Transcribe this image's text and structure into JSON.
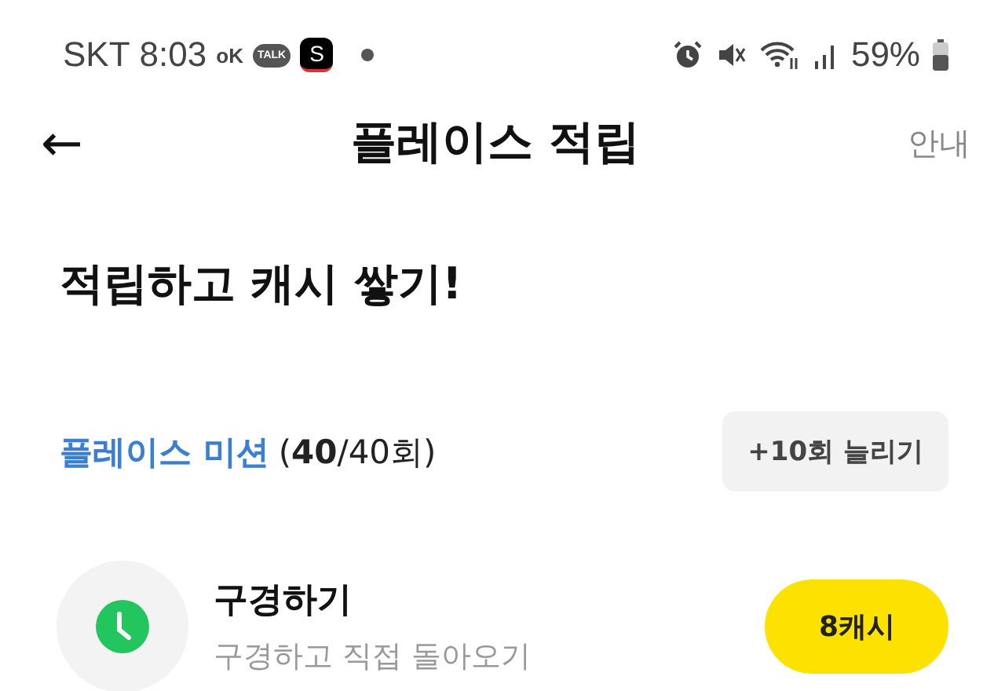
{
  "status_bar": {
    "carrier": "SKT",
    "time": "8:03",
    "ok_badge": "oK",
    "talk_badge": "TALK",
    "s_badge": "S",
    "battery": "59%"
  },
  "header": {
    "back": "←",
    "title": "플레이스 적립",
    "info": "안내"
  },
  "headline": "적립하고 캐시 쌓기!",
  "mission": {
    "title": "플레이스 미션",
    "count": "(**40**/40회)",
    "extend_button": "+10회 늘리기"
  },
  "tasks": [
    {
      "title": "구경하기",
      "subtitle": "구경하고 직접 돌아오기",
      "reward": "8캐시"
    }
  ]
}
